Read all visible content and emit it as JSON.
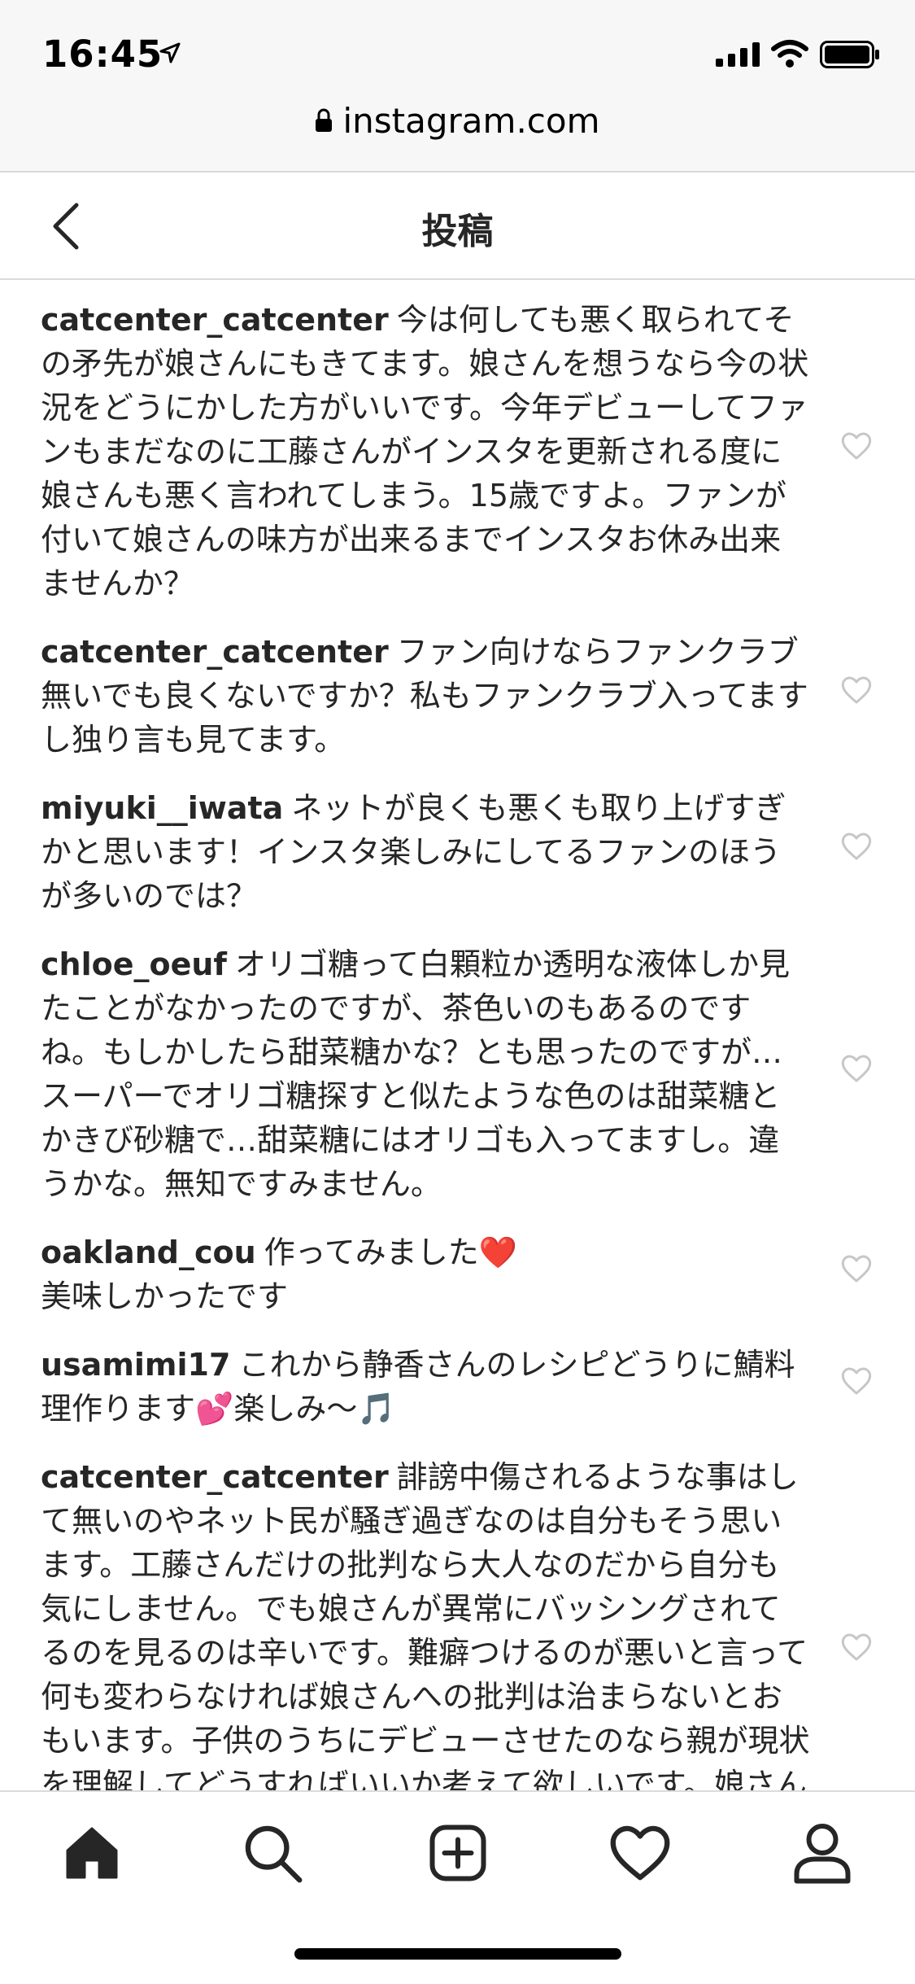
{
  "status_bar": {
    "time": "16:45"
  },
  "browser": {
    "url": "instagram.com"
  },
  "header": {
    "title": "投稿"
  },
  "comments": [
    {
      "username": "catcenter_catcenter",
      "text": "今は何しても悪く取られてその矛先が娘さんにもきてます。娘さんを想うなら今の状況をどうにかした方がいいです。今年デビューしてファンもまだなのに工藤さんがインスタを更新される度に娘さんも悪く言われてしまう。15歳ですよ。ファンが付いて娘さんの味方が出来るまでインスタお休み出来ませんか？"
    },
    {
      "username": "catcenter_catcenter",
      "text": "ファン向けならファンクラブ無いでも良くないですか？私もファンクラブ入ってますし独り言も見てます。"
    },
    {
      "username": "miyuki__iwata",
      "text": "ネットが良くも悪くも取り上げすぎかと思います！インスタ楽しみにしてるファンのほうが多いのでは？"
    },
    {
      "username": "chloe_oeuf",
      "text": "オリゴ糖って白顆粒か透明な液体しか見たことがなかったのですが、茶色いのもあるのですね。もしかしたら甜菜糖かな？とも思ったのですが…スーパーでオリゴ糖探すと似たような色のは甜菜糖とかきび砂糖で…甜菜糖にはオリゴも入ってますし。違うかな。無知ですみません。"
    },
    {
      "username": "oakland_cou",
      "text": "作ってみました❤️\n美味しかったです"
    },
    {
      "username": "usamimi17",
      "text": "これから静香さんのレシピどうりに鯖料理作ります💕楽しみ〜🎵"
    },
    {
      "username": "catcenter_catcenter",
      "text": "誹謗中傷されるような事はして無いのやネット民が騒ぎ過ぎなのは自分もそう思います。工藤さんだけの批判なら大人なのだから自分も気にしません。でも娘さんが異常にバッシングされてるのを見るのは辛いです。難癖つけるのが悪いと言って何も変わらなければ娘さんへの批判は治まらないとおもいます。子供のうちにデビューさせたのなら親が現状を理解してどうすればいいか考えて欲しいです。娘さん本人は健気に頑張ってるのにこんなに嫌わ"
    }
  ],
  "tabs": [
    {
      "name": "home",
      "icon": "home-icon",
      "active": true
    },
    {
      "name": "search",
      "icon": "search-icon"
    },
    {
      "name": "new-post",
      "icon": "add-post-icon"
    },
    {
      "name": "activity",
      "icon": "heart-icon"
    },
    {
      "name": "profile",
      "icon": "profile-icon"
    }
  ],
  "colors": {
    "text": "#262626",
    "icon_gray": "#c7c7c7",
    "border": "#dbdbdb",
    "browser_bg": "#f7f7f7"
  }
}
